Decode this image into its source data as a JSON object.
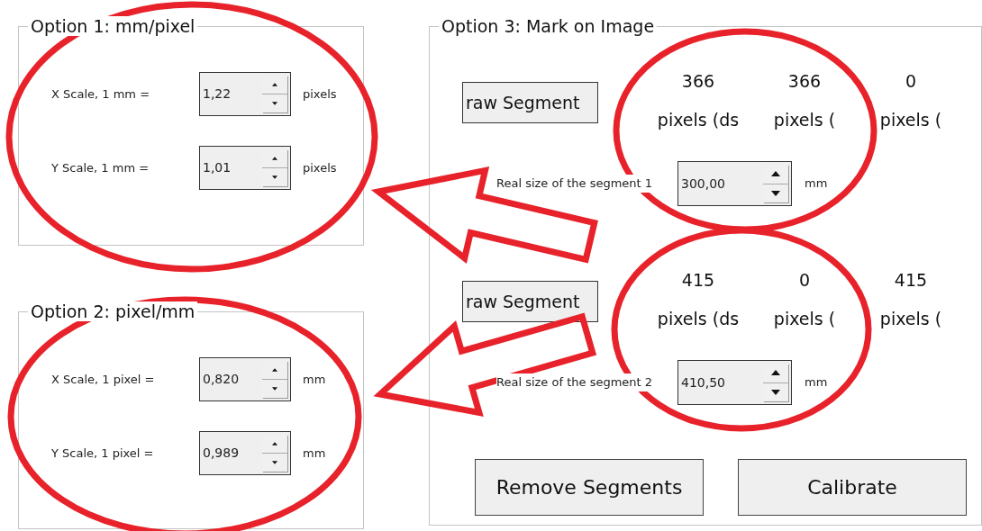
{
  "option_1": {
    "title": "Option 1: mm/pixel",
    "rows": [
      {
        "label": "X Scale, 1 mm =",
        "value": "1,22",
        "unit": "pixels"
      },
      {
        "label": "Y Scale, 1 mm =",
        "value": "1,01",
        "unit": "pixels"
      }
    ]
  },
  "option_2": {
    "title": "Option 2: pixel/mm",
    "rows": [
      {
        "label": "X Scale, 1 pixel =",
        "value": "0,820",
        "unit": "mm"
      },
      {
        "label": "Y Scale, 1 pixel =",
        "value": "0,989",
        "unit": "mm"
      }
    ]
  },
  "option_3": {
    "title": "Option 3: Mark on Image",
    "segments": [
      {
        "button": "raw Segment",
        "values": [
          "366",
          "366",
          "0"
        ],
        "labels": [
          "pixels (ds",
          "pixels (",
          "pixels ("
        ],
        "real_size_label": "Real size of the segment 1",
        "real_size": "300,00",
        "unit": "mm"
      },
      {
        "button": "raw Segment",
        "values": [
          "415",
          "0",
          "415"
        ],
        "labels": [
          "pixels (ds",
          "pixels (",
          "pixels ("
        ],
        "real_size_label": "Real size of the segment 2",
        "real_size": "410,50",
        "unit": "mm"
      }
    ],
    "buttons": [
      "Remove Segments",
      "Calibrate"
    ]
  }
}
